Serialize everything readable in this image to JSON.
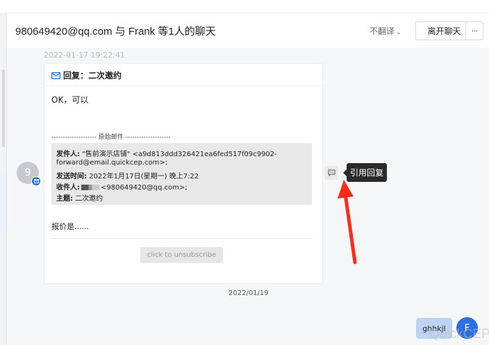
{
  "header": {
    "title": "980649420@qq.com 与 Frank 等1人的聊天",
    "translate_label": "不翻译",
    "leave_button": "离开聊天",
    "more_button": "···"
  },
  "chat": {
    "timestamp": "2022-01-17 19:22:41",
    "sender_avatar_initial": "9",
    "email": {
      "subject": "回复：二次邀约",
      "body_line1": "OK，可以",
      "original_separator": "-------------------- 原始邮件 --------------------",
      "quoted": {
        "from_label": "发件人:",
        "from_value": "\"售前演示店铺\" <a9d813ddd326421ea6fed517f09c9902-",
        "from_value_cont": "forward@email.quickcep.com>;",
        "sent_label": "发送时间:",
        "sent_value": "2022年1月17日(星期一) 晚上7:22",
        "to_label": "收件人:",
        "to_value": "<980649420@qq.com>;",
        "subject_label": "主题:",
        "subject_value": "二次邀约"
      },
      "body_line2": "报价是......",
      "unsubscribe_label": "click to unsubscribe"
    },
    "quote_reply_tooltip": "引用回复",
    "date_divider": "2022/01/19",
    "outgoing_message": "ghhkjl",
    "outgoing_avatar_initial": "F"
  },
  "watermark": "QuickCEP",
  "colors": {
    "accent": "#1f6fe5",
    "arrow": "#ff2a1a",
    "tooltip_bg": "#2b2b2b",
    "outgoing_bubble": "#bcd3f4"
  }
}
